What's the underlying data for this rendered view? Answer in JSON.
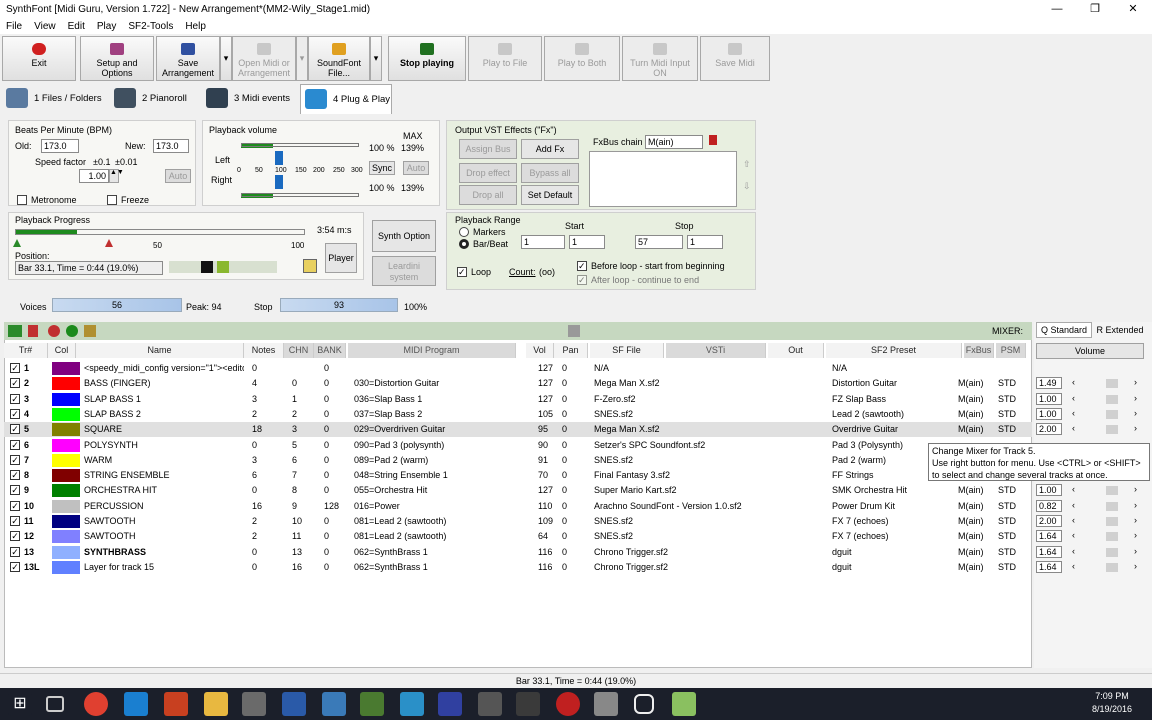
{
  "window": {
    "title": "SynthFont [Midi Guru, Version 1.722] - New Arrangement*(MM2-Wily_Stage1.mid)",
    "min": "—",
    "max": "❐",
    "close": "✕"
  },
  "menu": [
    "File",
    "View",
    "Edit",
    "Play",
    "SF2-Tools",
    "Help"
  ],
  "toolbar": {
    "exit": "Exit",
    "setup": "Setup and Options",
    "save1": "Save",
    "save2": "Arrangement",
    "open1": "Open Midi or",
    "open2": "Arrangement",
    "sf1": "SoundFont",
    "sf2": "File...",
    "stop": "Stop playing",
    "playfile": "Play to File",
    "playboth": "Play to Both",
    "midiin": "Turn Midi Input ON",
    "savemidi": "Save Midi"
  },
  "tabs": [
    "1 Files / Folders",
    "2 Pianoroll",
    "3 Midi events",
    "4 Plug & Play"
  ],
  "bpm": {
    "title": "Beats Per Minute (BPM)",
    "old_label": "Old:",
    "old": "173.0",
    "new_label": "New:",
    "new": "173.0",
    "speed": "Speed factor",
    "s1": "±0.1",
    "s2": "±0.01",
    "factor": "1.00",
    "auto": "Auto",
    "metronome": "Metronome",
    "freeze": "Freeze"
  },
  "vol": {
    "title": "Playback volume",
    "max": "MAX",
    "left": "Left",
    "right": "Right",
    "lp": "100 %",
    "lm": "139%",
    "rp": "100 %",
    "rm": "139%",
    "sync": "Sync",
    "auto": "Auto",
    "scale": [
      "0",
      "50",
      "100",
      "150",
      "200",
      "250",
      "300"
    ]
  },
  "fx": {
    "title": "Output VST Effects (\"Fx\")",
    "assign": "Assign Bus",
    "add": "Add Fx",
    "drop": "Drop effect",
    "bypass": "Bypass all",
    "dropall": "Drop all",
    "setdef": "Set Default",
    "chain": "FxBus chain",
    "chainsel": "M(ain)"
  },
  "progress": {
    "title": "Playback Progress",
    "time": "3:54 m:s",
    "pos_label": "Position:",
    "pos": "Bar 33.1, Time = 0:44 (19.0%)",
    "player": "Player",
    "t50": "50",
    "t100": "100"
  },
  "synth": {
    "opt": "Synth Option",
    "lead1": "Leardini",
    "lead2": "system"
  },
  "range": {
    "title": "Playback Range",
    "markers": "Markers",
    "barbeat": "Bar/Beat",
    "start": "Start",
    "stop": "Stop",
    "s1": "1",
    "s2": "1",
    "e1": "57",
    "e2": "1",
    "loop": "Loop",
    "count": "Count:",
    "countv": "(oo)",
    "before": "Before loop - start from beginning",
    "after": "After loop - continue to end"
  },
  "meters": {
    "voices": "Voices",
    "voicesv": "56",
    "peak": "Peak: 94",
    "stop": "Stop",
    "stopv": "93",
    "pct": "100%"
  },
  "mixer": {
    "label": "MIXER:",
    "tabq": "Q Standard",
    "tabr": "R Extended",
    "volume": "Volume"
  },
  "headers": {
    "tr": "Tr#",
    "col": "Col",
    "name": "Name",
    "notes": "Notes",
    "chn": "CHN",
    "bank": "BANK",
    "prog": "MIDI Program",
    "vol": "Vol",
    "pan": "Pan",
    "sf": "SF File",
    "vst": "VSTi",
    "out": "Out",
    "preset": "SF2 Preset",
    "fxbus": "FxBus",
    "psm": "PSM"
  },
  "tracks": [
    {
      "tr": "1",
      "col": "#800080",
      "name": "<speedy_midi_config version=\"1\"><editor_",
      "notes": "0",
      "chn": "",
      "bank": "0",
      "prog": "",
      "vol": "127",
      "pan": "0",
      "sf": "N/A",
      "preset": "N/A",
      "fx": "",
      "psm": "",
      "mix": ""
    },
    {
      "tr": "2",
      "col": "#ff0000",
      "name": "BASS (FINGER)",
      "notes": "4",
      "chn": "0",
      "bank": "0",
      "prog": "030=Distortion Guitar",
      "vol": "127",
      "pan": "0",
      "sf": "Mega Man X.sf2",
      "preset": "Distortion Guitar",
      "fx": "M(ain)",
      "psm": "STD",
      "mix": "1.49"
    },
    {
      "tr": "3",
      "col": "#0000ff",
      "name": "SLAP BASS 1",
      "notes": "3",
      "chn": "1",
      "bank": "0",
      "prog": "036=Slap Bass 1",
      "vol": "127",
      "pan": "0",
      "sf": "F-Zero.sf2",
      "preset": "FZ Slap Bass",
      "fx": "M(ain)",
      "psm": "STD",
      "mix": "1.00"
    },
    {
      "tr": "4",
      "col": "#00ff00",
      "name": "SLAP BASS 2",
      "notes": "2",
      "chn": "2",
      "bank": "0",
      "prog": "037=Slap Bass 2",
      "vol": "105",
      "pan": "0",
      "sf": "SNES.sf2",
      "preset": "Lead 2 (sawtooth)",
      "fx": "M(ain)",
      "psm": "STD",
      "mix": "1.00"
    },
    {
      "tr": "5",
      "col": "#808000",
      "name": "SQUARE",
      "notes": "18",
      "chn": "3",
      "bank": "0",
      "prog": "029=Overdriven Guitar",
      "vol": "95",
      "pan": "0",
      "sf": "Mega Man X.sf2",
      "preset": "Overdrive Guitar",
      "fx": "M(ain)",
      "psm": "STD",
      "mix": "2.00"
    },
    {
      "tr": "6",
      "col": "#ff00ff",
      "name": "POLYSYNTH",
      "notes": "0",
      "chn": "5",
      "bank": "0",
      "prog": "090=Pad 3 (polysynth)",
      "vol": "90",
      "pan": "0",
      "sf": "Setzer's SPC Soundfont.sf2",
      "preset": "Pad 3 (Polysynth)",
      "fx": "",
      "psm": "",
      "mix": ""
    },
    {
      "tr": "7",
      "col": "#ffff00",
      "name": "WARM",
      "notes": "3",
      "chn": "6",
      "bank": "0",
      "prog": "089=Pad 2 (warm)",
      "vol": "91",
      "pan": "0",
      "sf": "SNES.sf2",
      "preset": "Pad 2 (warm)",
      "fx": "",
      "psm": "",
      "mix": ""
    },
    {
      "tr": "8",
      "col": "#800000",
      "name": "STRING ENSEMBLE",
      "notes": "6",
      "chn": "7",
      "bank": "0",
      "prog": "048=String Ensemble 1",
      "vol": "70",
      "pan": "0",
      "sf": "Final Fantasy 3.sf2",
      "preset": "FF Strings",
      "fx": "",
      "psm": "",
      "mix": ""
    },
    {
      "tr": "9",
      "col": "#008000",
      "name": "ORCHESTRA HIT",
      "notes": "0",
      "chn": "8",
      "bank": "0",
      "prog": "055=Orchestra Hit",
      "vol": "127",
      "pan": "0",
      "sf": "Super Mario Kart.sf2",
      "preset": "SMK Orchestra Hit",
      "fx": "M(ain)",
      "psm": "STD",
      "mix": "1.00"
    },
    {
      "tr": "10",
      "col": "#c0c0c0",
      "name": "PERCUSSION",
      "notes": "16",
      "chn": "9",
      "bank": "128",
      "prog": "016=Power",
      "vol": "110",
      "pan": "0",
      "sf": "Arachno SoundFont - Version 1.0.sf2",
      "preset": "Power Drum Kit",
      "fx": "M(ain)",
      "psm": "STD",
      "mix": "0.82"
    },
    {
      "tr": "11",
      "col": "#000080",
      "name": "SAWTOOTH",
      "notes": "2",
      "chn": "10",
      "bank": "0",
      "prog": "081=Lead 2 (sawtooth)",
      "vol": "109",
      "pan": "0",
      "sf": "SNES.sf2",
      "preset": "FX 7 (echoes)",
      "fx": "M(ain)",
      "psm": "STD",
      "mix": "2.00"
    },
    {
      "tr": "12",
      "col": "#8080ff",
      "name": "SAWTOOTH",
      "notes": "2",
      "chn": "11",
      "bank": "0",
      "prog": "081=Lead 2 (sawtooth)",
      "vol": "64",
      "pan": "0",
      "sf": "SNES.sf2",
      "preset": "FX 7 (echoes)",
      "fx": "M(ain)",
      "psm": "STD",
      "mix": "1.64"
    },
    {
      "tr": "13",
      "col": "#8fb0ff",
      "name": "SYNTHBRASS",
      "notes": "0",
      "chn": "13",
      "bank": "0",
      "prog": "062=SynthBrass 1",
      "vol": "116",
      "pan": "0",
      "sf": "Chrono Trigger.sf2",
      "preset": "dguit",
      "fx": "M(ain)",
      "psm": "STD",
      "mix": "1.64"
    },
    {
      "tr": "13L",
      "col": "#6080ff",
      "name": "Layer for track 15",
      "notes": "0",
      "chn": "16",
      "bank": "0",
      "prog": "062=SynthBrass 1",
      "vol": "116",
      "pan": "0",
      "sf": "Chrono Trigger.sf2",
      "preset": "dguit",
      "fx": "M(ain)",
      "psm": "STD",
      "mix": "1.64"
    }
  ],
  "tooltip": {
    "l1": "Change Mixer for Track 5.",
    "l2": "Use right button for menu. Use <CTRL> or <SHIFT>",
    "l3": "to select and change several tracks at once."
  },
  "status": "Bar 33.1, Time = 0:44 (19.0%)",
  "clock": {
    "time": "7:09 PM",
    "date": "8/19/2016"
  }
}
